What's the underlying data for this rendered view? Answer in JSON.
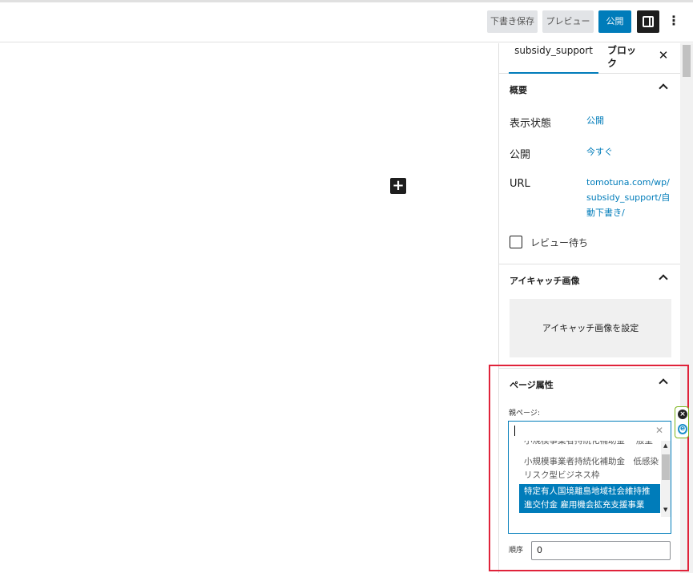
{
  "header": {
    "draft_label": "下書き保存",
    "preview_label": "プレビュー",
    "publish_label": "公開",
    "settings_icon": "sidebar-toggle-icon",
    "more_label": "⋮"
  },
  "canvas": {
    "add_block_label": "+"
  },
  "sidebar": {
    "tabs": [
      {
        "label": "subsidy_support",
        "active": true
      },
      {
        "label": "ブロック",
        "active": false
      }
    ],
    "close_label": "✕",
    "summary": {
      "title": "概要",
      "rows": [
        {
          "label": "表示状態",
          "value": "公開"
        },
        {
          "label": "公開",
          "value": "今すぐ"
        },
        {
          "label": "URL",
          "value_lines": [
            "tomotuna.com/wp/",
            "subsidy_support/自",
            "動下書き/"
          ]
        }
      ],
      "review_label": "レビュー待ち",
      "review_checked": false
    },
    "featured": {
      "title": "アイキャッチ画像",
      "set_label": "アイキャッチ画像を設定"
    },
    "page_attributes": {
      "title": "ページ属性",
      "parent_label": "親ページ:",
      "parent_input_value": "",
      "clear_label": "✕",
      "options": [
        "小規模事業者持続化補助金 一般型",
        "小規模事業者持続化補助金　低感染リスク型ビジネス枠",
        "特定有人国境離島地域社会維持推進交付金 雇用機会拡充支援事業"
      ],
      "selected_index": 2,
      "order_label": "順序",
      "order_value": "0"
    }
  },
  "colors": {
    "accent": "#007cba",
    "highlight_border": "#e0233a"
  }
}
